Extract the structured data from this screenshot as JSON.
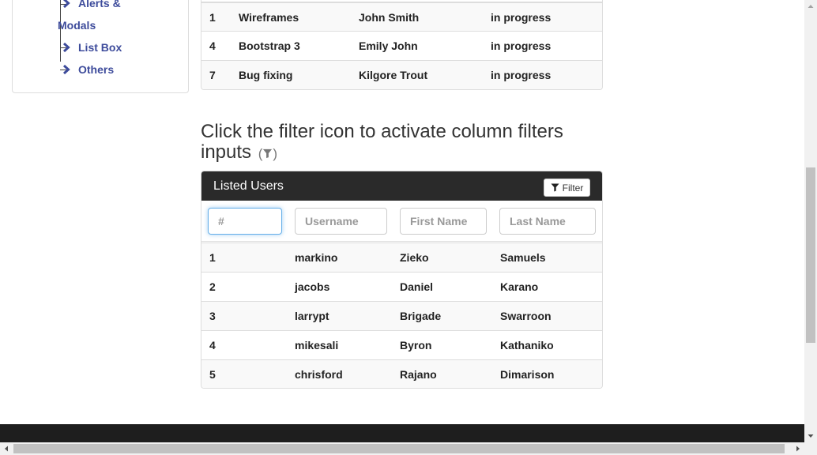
{
  "sidebar": {
    "items": [
      {
        "label_line1": "Alerts &",
        "label_line2": "Modals"
      },
      {
        "label": "List Box"
      },
      {
        "label": "Others"
      }
    ]
  },
  "top_table": {
    "rows": [
      {
        "id": "1",
        "task": "Wireframes",
        "assignee": "John Smith",
        "status": "in progress"
      },
      {
        "id": "4",
        "task": "Bootstrap 3",
        "assignee": "Emily John",
        "status": "in progress"
      },
      {
        "id": "7",
        "task": "Bug fixing",
        "assignee": "Kilgore Trout",
        "status": "in progress"
      }
    ]
  },
  "heading": {
    "text": "Click the filter icon to activate column filters inputs",
    "hint_open": "(",
    "hint_close": ")"
  },
  "users_panel": {
    "title": "Listed Users",
    "filter_button": "Filter",
    "filters": {
      "id_placeholder": "#",
      "username_placeholder": "Username",
      "first_name_placeholder": "First Name",
      "last_name_placeholder": "Last Name"
    },
    "rows": [
      {
        "id": "1",
        "username": "markino",
        "first_name": "Zieko",
        "last_name": "Samuels"
      },
      {
        "id": "2",
        "username": "jacobs",
        "first_name": "Daniel",
        "last_name": "Karano"
      },
      {
        "id": "3",
        "username": "larrypt",
        "first_name": "Brigade",
        "last_name": "Swarroon"
      },
      {
        "id": "4",
        "username": "mikesali",
        "first_name": "Byron",
        "last_name": "Kathaniko"
      },
      {
        "id": "5",
        "username": "chrisford",
        "first_name": "Rajano",
        "last_name": "Dimarison"
      }
    ]
  },
  "icons": {
    "tree_chevron": "chevron-right-icon",
    "filter": "filter-icon"
  },
  "colors": {
    "link": "#3d4b9b",
    "panel_heading": "#2a2a2a",
    "footer": "#1e1e1e",
    "focus": "#66afe9"
  }
}
